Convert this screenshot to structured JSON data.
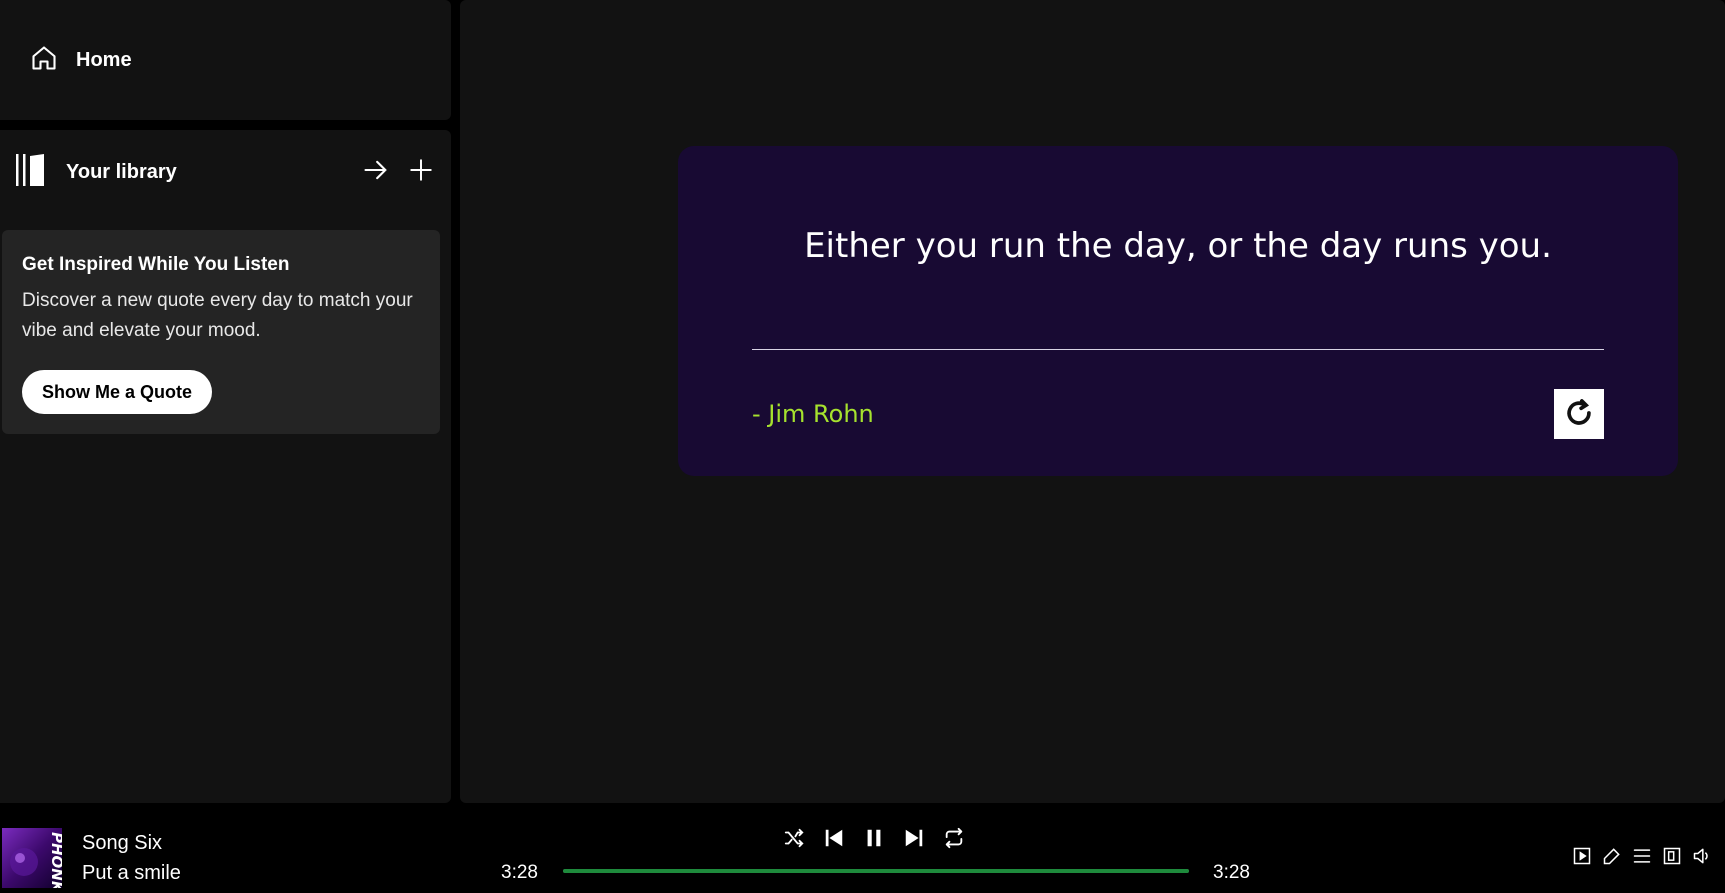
{
  "sidebar": {
    "home_label": "Home",
    "library_label": "Your library"
  },
  "promo": {
    "heading": "Get Inspired While You Listen",
    "description": "Discover a new quote every day to match your vibe and elevate your mood.",
    "button_label": "Show Me a Quote"
  },
  "quote": {
    "text": "Either you run the day, or the day runs you.",
    "author": "- Jim Rohn"
  },
  "player": {
    "track_title": "Song Six",
    "track_artist": "Put a smile",
    "album_art_text": "PHONK",
    "elapsed": "3:28",
    "duration": "3:28",
    "progress": 1.0
  },
  "icons": {
    "home": "home-icon",
    "library": "library-icon",
    "expand": "arrow-right-icon",
    "add": "plus-icon",
    "refresh": "refresh-icon",
    "shuffle": "shuffle-icon",
    "previous": "skip-previous-icon",
    "pause": "pause-icon",
    "next": "skip-next-icon",
    "repeat": "repeat-icon",
    "now_playing": "now-playing-view-icon",
    "lyrics": "lyrics-icon",
    "queue": "queue-icon",
    "devices": "connect-device-icon",
    "volume": "volume-icon"
  },
  "colors": {
    "background": "#121212",
    "card": "#180a33",
    "author": "#a6e22e",
    "progress": "#1e8a3c"
  }
}
